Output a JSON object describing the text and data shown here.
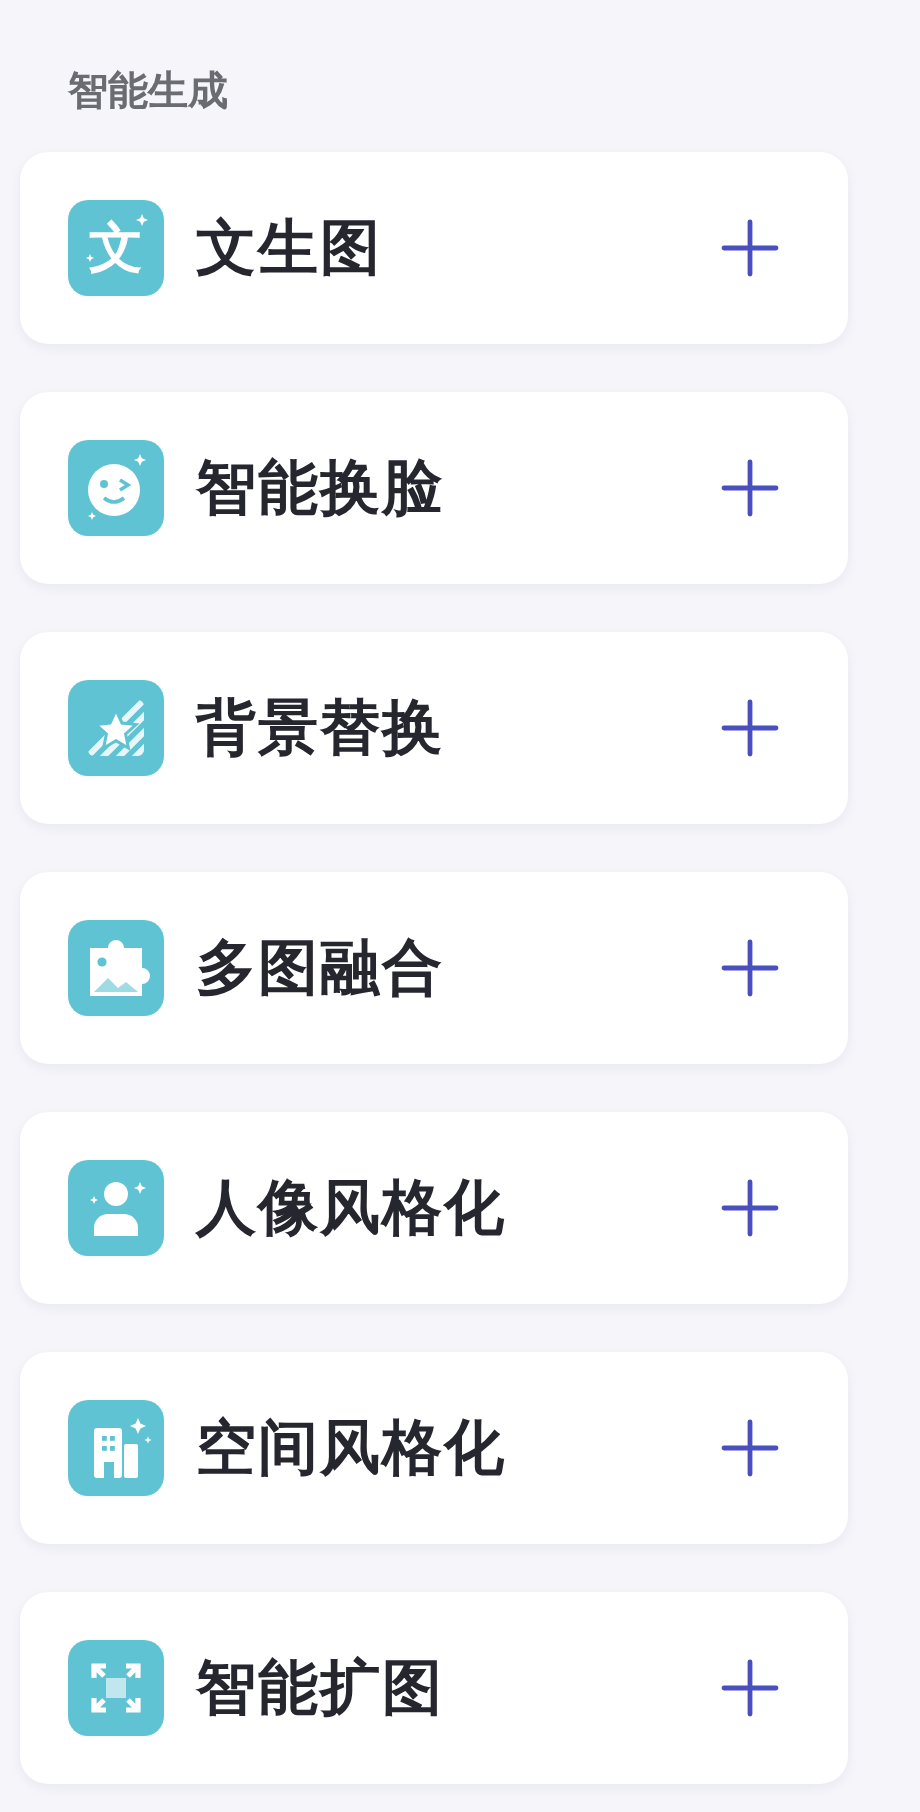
{
  "section_title": "智能生成",
  "items": [
    {
      "kind": "text",
      "icon_char": "文",
      "label": "文生图"
    },
    {
      "kind": "face",
      "label": "智能换脸"
    },
    {
      "kind": "background",
      "label": "背景替换"
    },
    {
      "kind": "puzzle",
      "label": "多图融合"
    },
    {
      "kind": "person",
      "label": "人像风格化"
    },
    {
      "kind": "building",
      "label": "空间风格化"
    },
    {
      "kind": "expand",
      "label": "智能扩图"
    }
  ]
}
